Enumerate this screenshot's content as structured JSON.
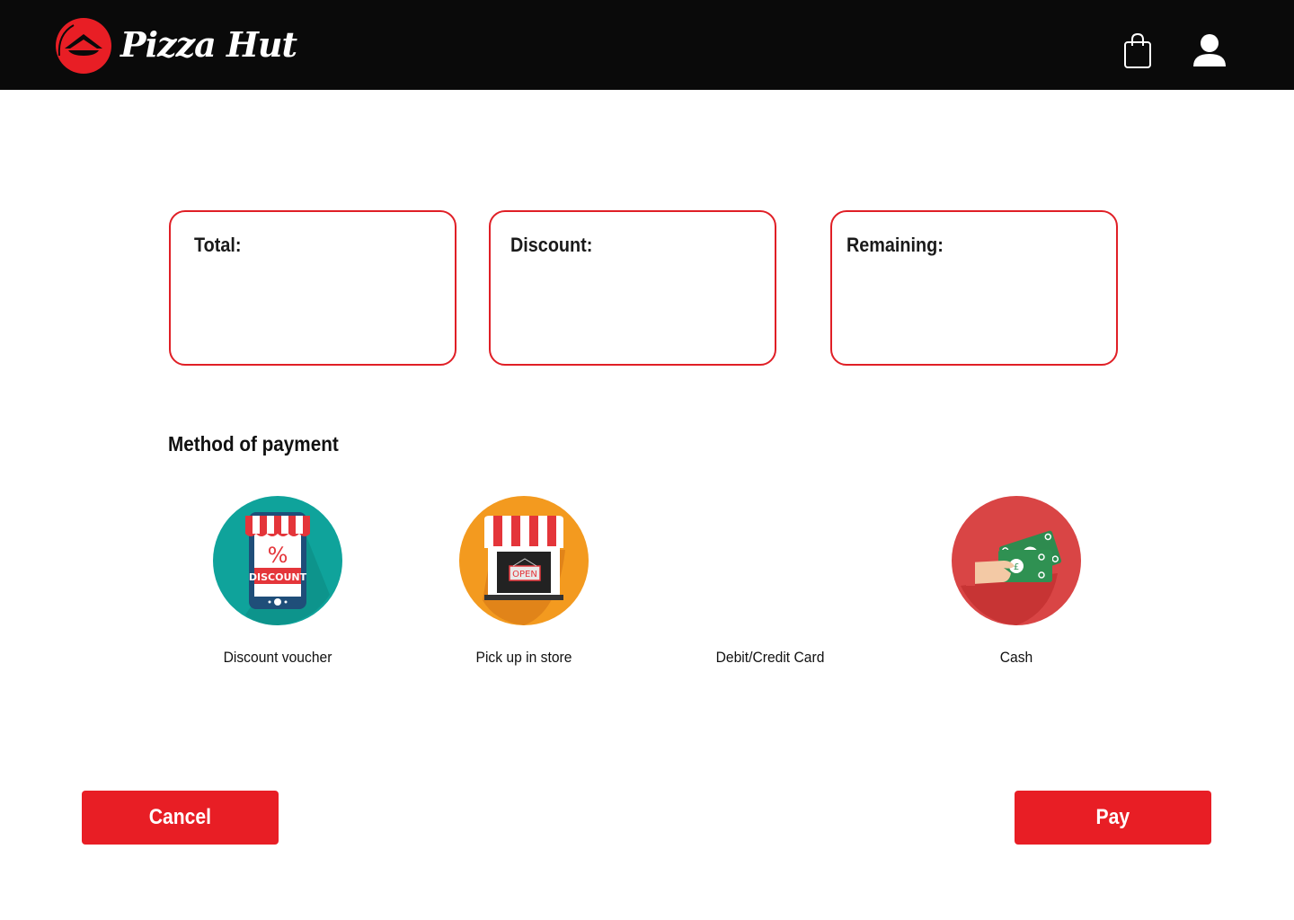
{
  "header": {
    "brand": "Pizza Hut",
    "logo_icon": "pizza-hut-roof-logo-icon",
    "cart_icon": "shopping-bag-icon",
    "account_icon": "user-icon"
  },
  "summary": {
    "total_label": "Total:",
    "discount_label": "Discount:",
    "remaining_label": "Remaining:"
  },
  "payment": {
    "title": "Method of payment",
    "methods": [
      {
        "label": "Discount voucher",
        "icon": "discount-voucher-icon"
      },
      {
        "label": "Pick up in store",
        "icon": "store-open-icon"
      },
      {
        "label": "Debit/Credit Card",
        "icon": ""
      },
      {
        "label": "Cash",
        "icon": "cash-hand-icon"
      }
    ]
  },
  "actions": {
    "cancel_label": "Cancel",
    "pay_label": "Pay"
  },
  "colors": {
    "brand_red": "#e81e25",
    "header_bg": "#0a0a0a",
    "card_border": "#e01f26"
  }
}
